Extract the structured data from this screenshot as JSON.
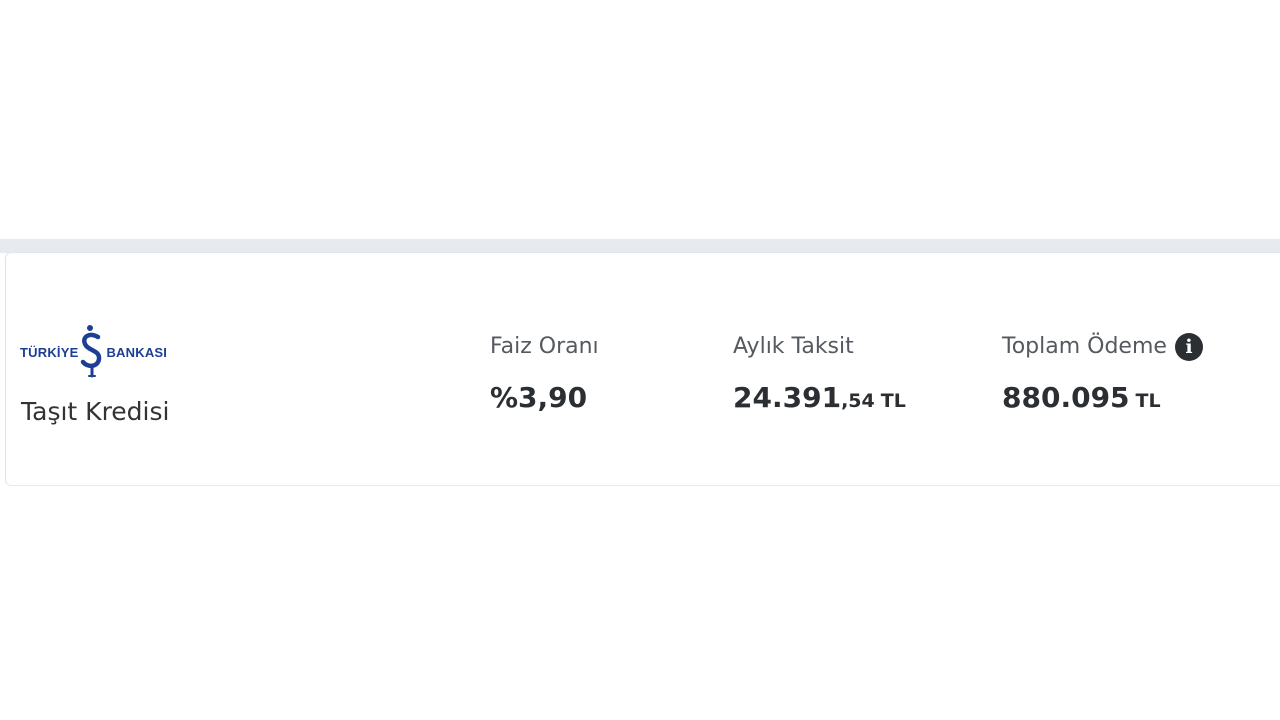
{
  "offer": {
    "bank_logo": {
      "left_word": "TÜRKİYE",
      "right_word": "BANKASI",
      "brand_color": "#1c3f95"
    },
    "product_name": "Taşıt Kredisi",
    "interest": {
      "label": "Faiz Oranı",
      "value": "%3,90"
    },
    "monthly": {
      "label": "Aylık Taksit",
      "value_main": "24.391",
      "value_decimal": ",54",
      "currency": "TL"
    },
    "total": {
      "label": "Toplam Ödeme",
      "value_main": "880.095",
      "currency": "TL",
      "info_icon": "info-icon"
    }
  }
}
